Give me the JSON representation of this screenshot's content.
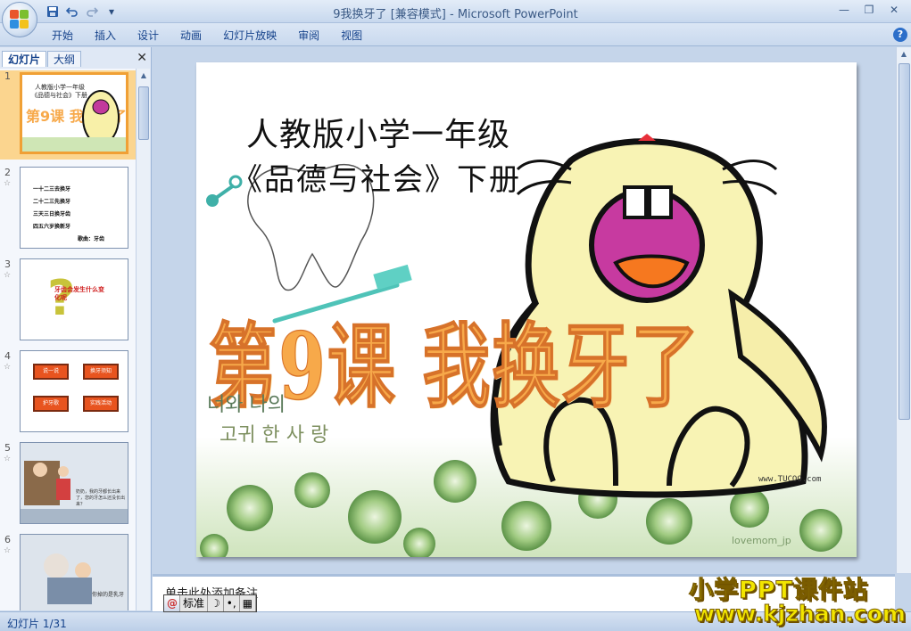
{
  "window": {
    "title_file": "9我换牙了",
    "title_mode": "[兼容模式]",
    "title_sep": " - ",
    "title_app": "Microsoft PowerPoint"
  },
  "quick_access": [
    "save-icon",
    "undo-icon",
    "redo-icon",
    "customize-icon"
  ],
  "ribbon": {
    "tabs": [
      "开始",
      "插入",
      "设计",
      "动画",
      "幻灯片放映",
      "审阅",
      "视图"
    ],
    "help_label": "?"
  },
  "left_panel": {
    "tab_slides": "幻灯片",
    "tab_outline": "大纲",
    "close_label": "✕",
    "thumbnails": [
      {
        "num": "1",
        "anim": "",
        "selected": true
      },
      {
        "num": "2",
        "anim": "☆",
        "selected": false
      },
      {
        "num": "3",
        "anim": "☆",
        "selected": false
      },
      {
        "num": "4",
        "anim": "☆",
        "selected": false
      },
      {
        "num": "5",
        "anim": "☆",
        "selected": false
      },
      {
        "num": "6",
        "anim": "☆",
        "selected": false
      }
    ],
    "thumb2_lines": [
      "一十二三去换牙",
      "二十二三先换牙",
      "三天三日换牙齿",
      "四五六岁换新牙",
      "歌曲：牙齿"
    ],
    "thumb3_text": "牙齿会发生什么变化呢",
    "thumb4_buttons": [
      "说一说",
      "换牙须知",
      "护牙歌",
      "实践活动"
    ],
    "thumb5_caption": "奶奶，我的牙都长出来了，您的牙怎么还没长出来？",
    "thumb6_caption": "你掉的是乳牙"
  },
  "slide": {
    "title_line1": "人教版小学一年级",
    "title_line2": "《品德与社会》下册",
    "lesson_title": "第9课 我换牙了",
    "korean_line1": "너와 나의",
    "korean_line2": "고귀 한 사 랑",
    "watermark_small": "www.TUCOO.com",
    "watermark_love": "lovemom_jp"
  },
  "notes": {
    "placeholder": "单击此处添加备注"
  },
  "ime": {
    "logo": "@",
    "mode": "标准",
    "moon": "☽",
    "punct": "•,",
    "keyboard": "▦"
  },
  "status": {
    "slide_counter": "幻灯片 1/31"
  },
  "site_watermark": {
    "line1": "小学PPT课件站",
    "line2": "www.kjzhan.com"
  },
  "colors": {
    "ribbon_text": "#15428b",
    "lesson_title": "#f7a94a",
    "selected_thumb": "#f0a035"
  }
}
